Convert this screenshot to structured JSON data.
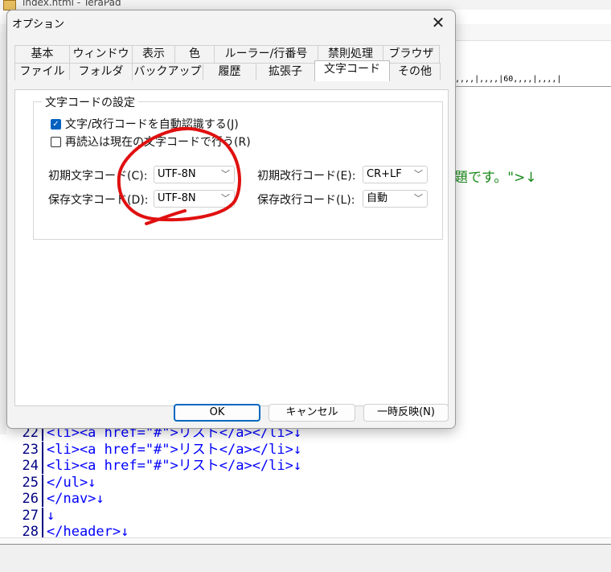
{
  "background_window": {
    "title": "index.html - TeraPad",
    "ruler_text": "0,,,,|,,,,|60,,,,|,,,,|",
    "visible_text_fragment": "題です。\">↓",
    "code_lines": [
      {
        "num": "22",
        "text": "<li><a href=\"#\">リスト</a></li>↓"
      },
      {
        "num": "23",
        "text": "<li><a href=\"#\">リスト</a></li>↓"
      },
      {
        "num": "24",
        "text": "<li><a href=\"#\">リスト</a></li>↓"
      },
      {
        "num": "25",
        "text": "</ul>↓"
      },
      {
        "num": "26",
        "text": "</nav>↓"
      },
      {
        "num": "27",
        "text": "↓"
      },
      {
        "num": "28",
        "text": "</header>↓"
      }
    ]
  },
  "dialog": {
    "title": "オプション",
    "close_glyph": "✕",
    "tabs_row1": [
      "基本",
      "ウィンドウ",
      "表示",
      "色",
      "ルーラー/行番号",
      "禁則処理",
      "ブラウザ"
    ],
    "tabs_row2": [
      "ファイル",
      "フォルダ",
      "バックアップ",
      "履歴",
      "拡張子",
      "文字コード",
      "その他"
    ],
    "active_tab": "文字コード",
    "group_label": "文字コードの設定",
    "checkbox_auto_detect": {
      "label": "文字/改行コードを自動認識する(J)",
      "checked": true
    },
    "checkbox_reload": {
      "label": "再読込は現在の文字コードで行う(R)",
      "checked": false
    },
    "initial_charcode": {
      "label": "初期文字コード(C):",
      "value": "UTF-8N"
    },
    "save_charcode": {
      "label": "保存文字コード(D):",
      "value": "UTF-8N"
    },
    "initial_linebreak": {
      "label": "初期改行コード(E):",
      "value": "CR+LF"
    },
    "save_linebreak": {
      "label": "保存改行コード(L):",
      "value": "自動"
    },
    "buttons": {
      "ok": "OK",
      "cancel": "キャンセル",
      "apply": "一時反映(N)"
    },
    "accent_color": "#0067c0"
  },
  "annotation": {
    "color": "#e01010",
    "shape": "hand-drawn circle around charcode dropdowns"
  }
}
